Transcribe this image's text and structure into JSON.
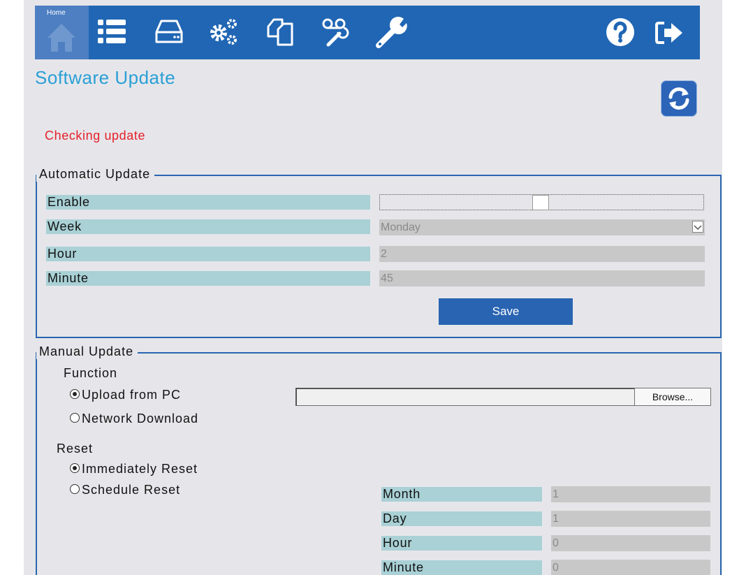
{
  "toolbar": {
    "home_label": "Home",
    "icons": [
      "home-icon",
      "list-icon",
      "storage-icon",
      "settings-gears-icon",
      "copy-pages-icon",
      "voicemail-settings-icon",
      "wrench-icon",
      "help-icon",
      "logout-icon"
    ]
  },
  "page": {
    "title": "Software Update",
    "status": "Checking update",
    "status_color": "#e5202a",
    "accent": "#2066b4"
  },
  "automatic": {
    "legend": "Automatic Update",
    "enable_label": "Enable",
    "week_label": "Week",
    "week_value": "Monday",
    "hour_label": "Hour",
    "hour_value": "2",
    "minute_label": "Minute",
    "minute_value": "45",
    "save_label": "Save"
  },
  "manual": {
    "legend": "Manual Update",
    "function_label": "Function",
    "upload_label": "Upload from PC",
    "network_label": "Network Download",
    "browse_label": "Browse...",
    "reset_label": "Reset",
    "immediate_label": "Immediately Reset",
    "schedule_label": "Schedule Reset",
    "month_label": "Month",
    "month_value": "1",
    "day_label": "Day",
    "day_value": "1",
    "hour_label": "Hour",
    "hour_value": "0",
    "minute_label": "Minute",
    "minute_value": "0"
  }
}
